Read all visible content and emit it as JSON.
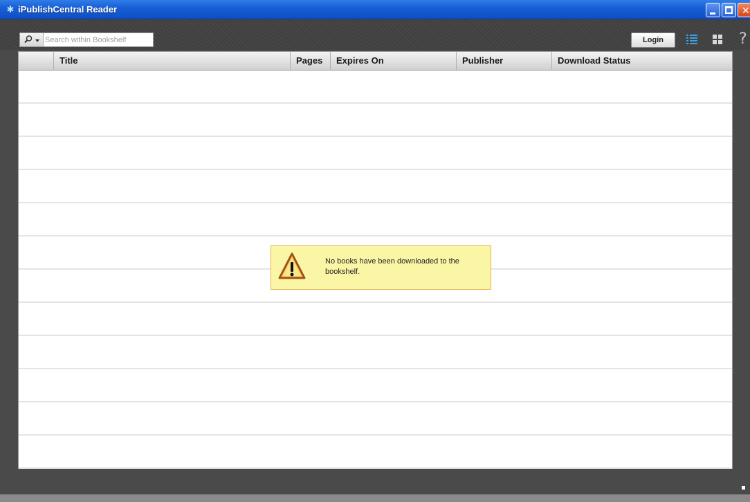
{
  "window": {
    "title": "iPublishCentral Reader"
  },
  "toolbar": {
    "search_placeholder": "Search within Bookshelf",
    "login_label": "Login",
    "help_label": "?"
  },
  "table": {
    "columns": [
      "",
      "Title",
      "Pages",
      "Expires On",
      "Publisher",
      "Download Status"
    ],
    "rows": []
  },
  "message": {
    "text": "No books have been downloaded to the bookshelf.",
    "icon": "warning-icon"
  },
  "colors": {
    "titlebar": "#1a5fd6",
    "toolbar": "#434343",
    "message_bg": "#fbf6a6",
    "message_border": "#e8b048",
    "view_icon_active": "#3aa0e8"
  }
}
